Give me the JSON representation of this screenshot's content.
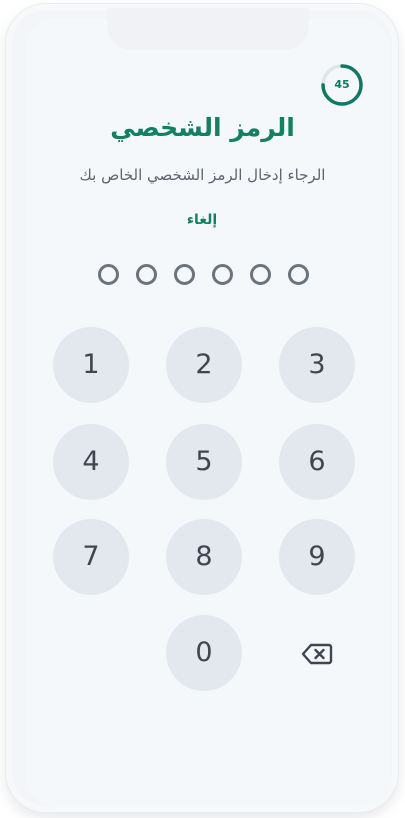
{
  "timer": {
    "seconds": "45",
    "progress": 0.75,
    "color": "#0f7a64"
  },
  "header": {
    "title": "الرمز الشخصي",
    "subtitle": "الرجاء إدخال الرمز الشخصي الخاص بك",
    "cancel_label": "إلغاء"
  },
  "pin": {
    "length": 6,
    "entered": 0
  },
  "keypad": {
    "keys": [
      "1",
      "2",
      "3",
      "4",
      "5",
      "6",
      "7",
      "8",
      "9",
      "0"
    ],
    "delete_icon": "backspace-icon"
  },
  "colors": {
    "accent": "#138064",
    "key_bg": "#e3e8ee",
    "dot": "#6b737d"
  }
}
